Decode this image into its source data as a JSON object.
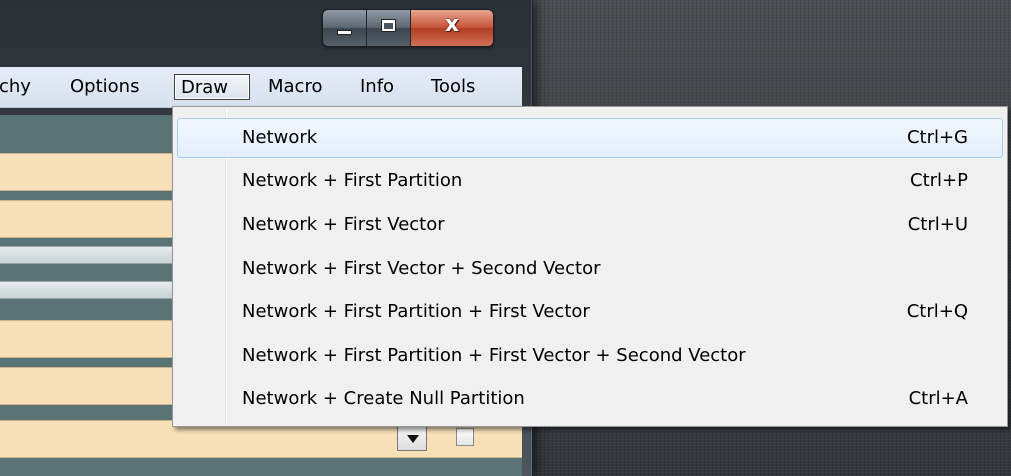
{
  "window": {
    "caption": {
      "minimize_icon": "minimize-icon",
      "maximize_icon": "maximize-icon",
      "close_label": "x"
    }
  },
  "menubar": {
    "items": [
      {
        "label": "rchy"
      },
      {
        "label": "Options"
      },
      {
        "label": "Draw"
      },
      {
        "label": "Macro"
      },
      {
        "label": "Info"
      },
      {
        "label": "Tools"
      }
    ],
    "active": "Draw"
  },
  "draw_menu": {
    "items": [
      {
        "label": "Network",
        "shortcut": "Ctrl+G"
      },
      {
        "label": "Network + First Partition",
        "shortcut": "Ctrl+P"
      },
      {
        "label": "Network + First Vector",
        "shortcut": "Ctrl+U"
      },
      {
        "label": "Network + First Vector + Second Vector",
        "shortcut": ""
      },
      {
        "label": "Network + First Partition + First Vector",
        "shortcut": "Ctrl+Q"
      },
      {
        "label": "Network + First Partition + First Vector + Second Vector",
        "shortcut": ""
      },
      {
        "label": "Network + Create Null Partition",
        "shortcut": "Ctrl+A"
      }
    ],
    "highlighted_index": 0
  },
  "colors": {
    "desktop": "#3a3d41",
    "menu_bg": "#f0f0f0",
    "highlight_border": "#a8cbf0",
    "field_tan": "#f7e0b8",
    "pane_slate": "#5a7476",
    "close_red": "#c9553d"
  },
  "icons": {
    "dropdown_arrow": "chevron-down-icon",
    "checkbox": "checkbox-icon"
  }
}
